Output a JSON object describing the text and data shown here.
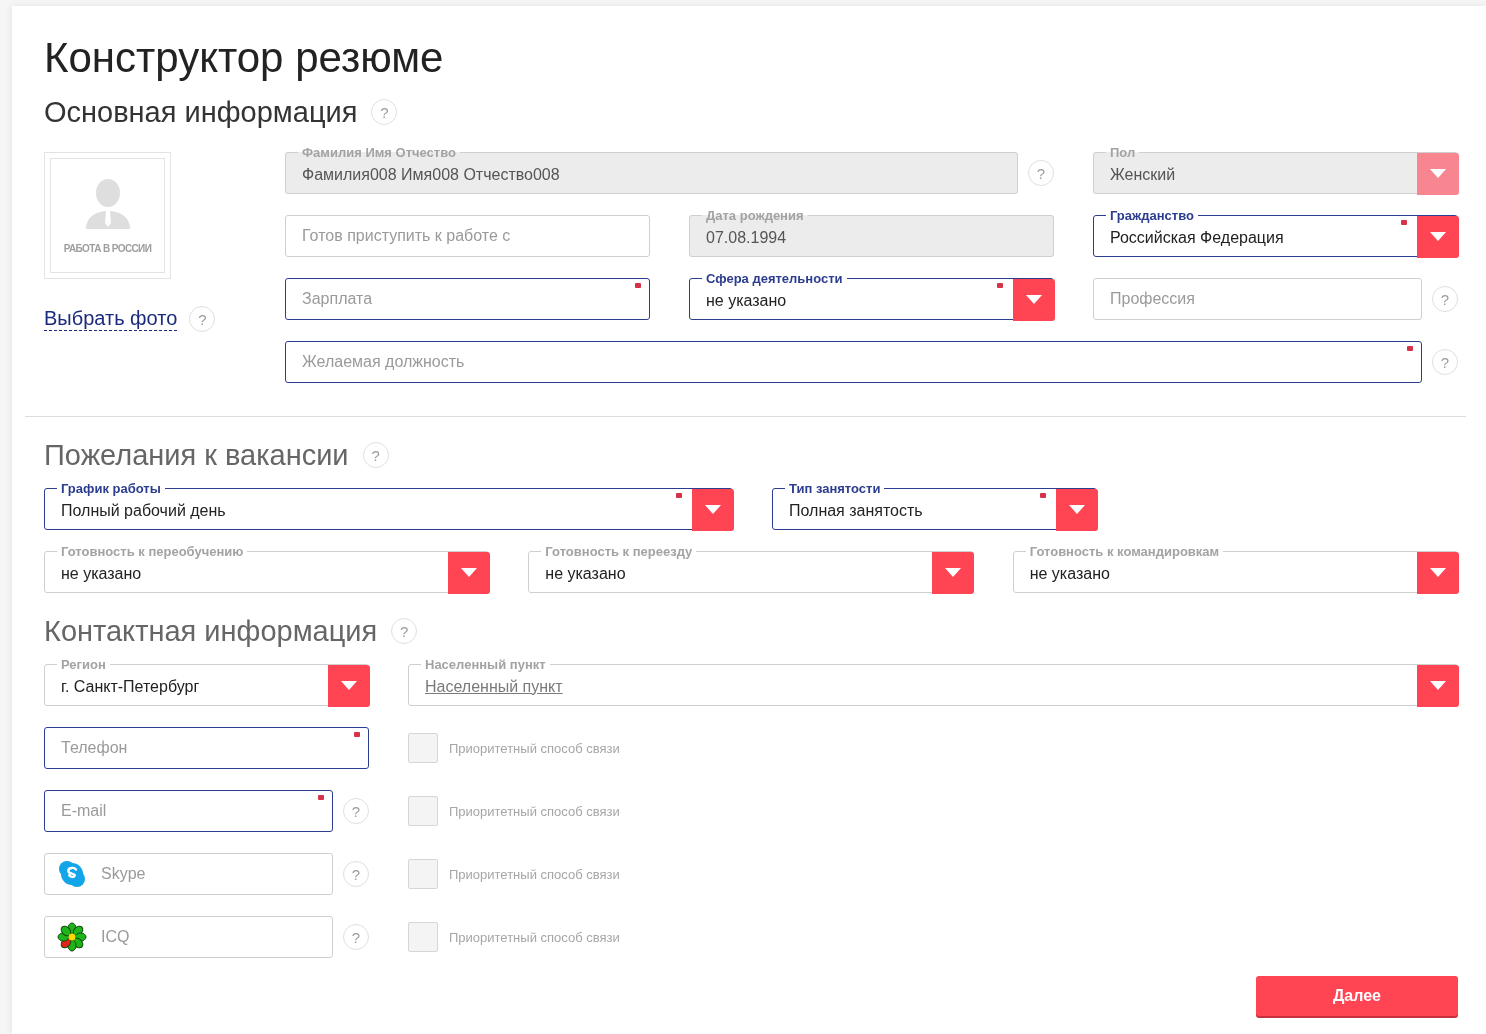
{
  "title": "Конструктор резюме",
  "basic": {
    "heading": "Основная информация",
    "help": "?",
    "photo": {
      "caption": "РАБОТА В РОССИИ",
      "link": "Выбрать фото",
      "help": "?"
    },
    "rows": [
      [
        {
          "kind": "text",
          "label": "Фамилия Имя Отчество",
          "value": "Фамилия008 Имя008 Отчество008",
          "disabled": true,
          "required": false,
          "help": "?"
        },
        "",
        {
          "kind": "select",
          "label": "Пол",
          "value": "Женский",
          "disabled": true,
          "required": false
        }
      ],
      [
        {
          "kind": "text",
          "placeholder": "Готов приступить к работе с",
          "disabled": false,
          "required": false
        },
        {
          "kind": "text",
          "label": "Дата рождения",
          "value": "07.08.1994",
          "disabled": true,
          "required": false
        },
        {
          "kind": "select",
          "label": "Гражданство",
          "value": "Российская Федерация",
          "disabled": false,
          "required": true
        }
      ],
      [
        {
          "kind": "text",
          "placeholder": "Зарплата",
          "disabled": false,
          "required": true
        },
        {
          "kind": "select",
          "label": "Сфера деятельности",
          "value": "не указано",
          "disabled": false,
          "required": true
        },
        {
          "kind": "text",
          "placeholder": "Профессия",
          "disabled": false,
          "required": false,
          "help": "?"
        }
      ],
      [
        {
          "kind": "text",
          "placeholder": "Желаемая должность",
          "disabled": false,
          "required": true,
          "help": "?"
        },
        "",
        ""
      ]
    ]
  },
  "wishes": {
    "heading": "Пожелания к вакансии",
    "help": "?",
    "rows": [
      [
        {
          "kind": "select",
          "label": "График работы",
          "value": "Полный рабочий день",
          "disabled": false,
          "required": true
        },
        {
          "kind": "select",
          "label": "Тип занятости",
          "value": "Полная занятость",
          "disabled": false,
          "required": true
        }
      ],
      [
        {
          "kind": "select",
          "label": "Готовность к переобучению",
          "value": "не указано",
          "disabled": false,
          "required": false
        },
        {
          "kind": "select",
          "label": "Готовность к переезду",
          "value": "не указано",
          "disabled": false,
          "required": false
        },
        {
          "kind": "select",
          "label": "Готовность к командировкам",
          "value": "не указано",
          "disabled": false,
          "required": false
        }
      ]
    ]
  },
  "contacts": {
    "heading": "Контактная информация",
    "help": "?",
    "location": [
      {
        "kind": "select",
        "label": "Регион",
        "value": "г. Санкт-Петербург",
        "disabled": false,
        "required": false
      },
      {
        "kind": "select",
        "label": "Населенный пункт",
        "placeholder": "Населенный пункт",
        "disabled": false,
        "required": false
      }
    ],
    "channels": [
      {
        "field": {
          "kind": "text",
          "placeholder": "Телефон",
          "disabled": false,
          "required": true
        },
        "priority": {
          "label": "Приоритетный способ связи",
          "checked": false
        }
      },
      {
        "field": {
          "kind": "text",
          "placeholder": "E-mail",
          "disabled": false,
          "required": true,
          "help": "?"
        },
        "priority": {
          "label": "Приоритетный способ связи",
          "checked": false
        }
      },
      {
        "field": {
          "kind": "skype",
          "placeholder": "Skype",
          "disabled": false,
          "required": false,
          "help": "?"
        },
        "priority": {
          "label": "Приоритетный способ связи",
          "checked": false
        }
      },
      {
        "field": {
          "kind": "icq",
          "placeholder": "ICQ",
          "disabled": false,
          "required": false,
          "help": "?"
        },
        "priority": {
          "label": "Приоритетный способ связи",
          "checked": false
        }
      }
    ]
  },
  "next_button": "Далее"
}
